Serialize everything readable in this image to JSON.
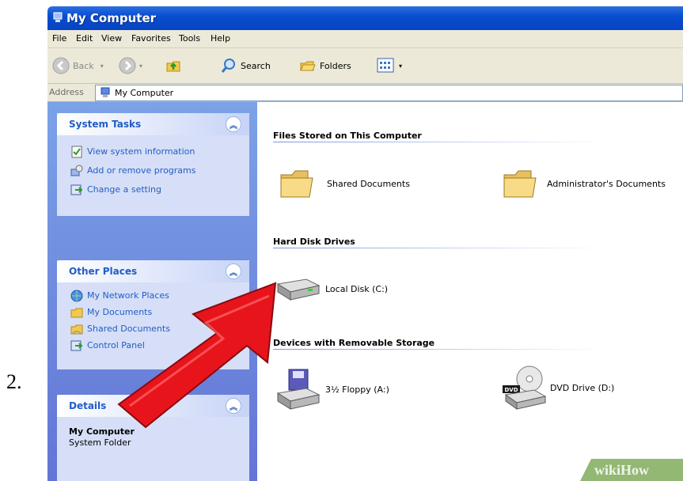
{
  "step_number": "2.",
  "window": {
    "title": "My Computer"
  },
  "menu": {
    "items": [
      "File",
      "Edit",
      "View",
      "Favorites",
      "Tools",
      "Help"
    ]
  },
  "toolbar": {
    "back": "Back",
    "search": "Search",
    "folders": "Folders"
  },
  "address": {
    "label": "Address",
    "value": "My Computer"
  },
  "left_pane": {
    "system_tasks": {
      "title": "System Tasks",
      "items": [
        "View system information",
        "Add or remove programs",
        "Change a setting"
      ]
    },
    "other_places": {
      "title": "Other Places",
      "items": [
        "My Network Places",
        "My Documents",
        "Shared Documents",
        "Control Panel"
      ]
    },
    "details": {
      "title": "Details",
      "name": "My Computer",
      "type": "System Folder"
    }
  },
  "content": {
    "files_section": {
      "title": "Files Stored on This Computer",
      "items": [
        "Shared Documents",
        "Administrator's Documents"
      ]
    },
    "hdd_section": {
      "title": "Hard Disk Drives",
      "items": [
        "Local Disk (C:)"
      ]
    },
    "removable_section": {
      "title": "Devices with Removable Storage",
      "items": [
        "3½ Floppy (A:)",
        "DVD Drive (D:)"
      ]
    }
  },
  "watermark": "wikiHow",
  "colors": {
    "title_bar": "#0a4ed0",
    "task_pane_blue": "#6375d6",
    "link_blue": "#215dc6",
    "arrow_red": "#e8141c"
  }
}
